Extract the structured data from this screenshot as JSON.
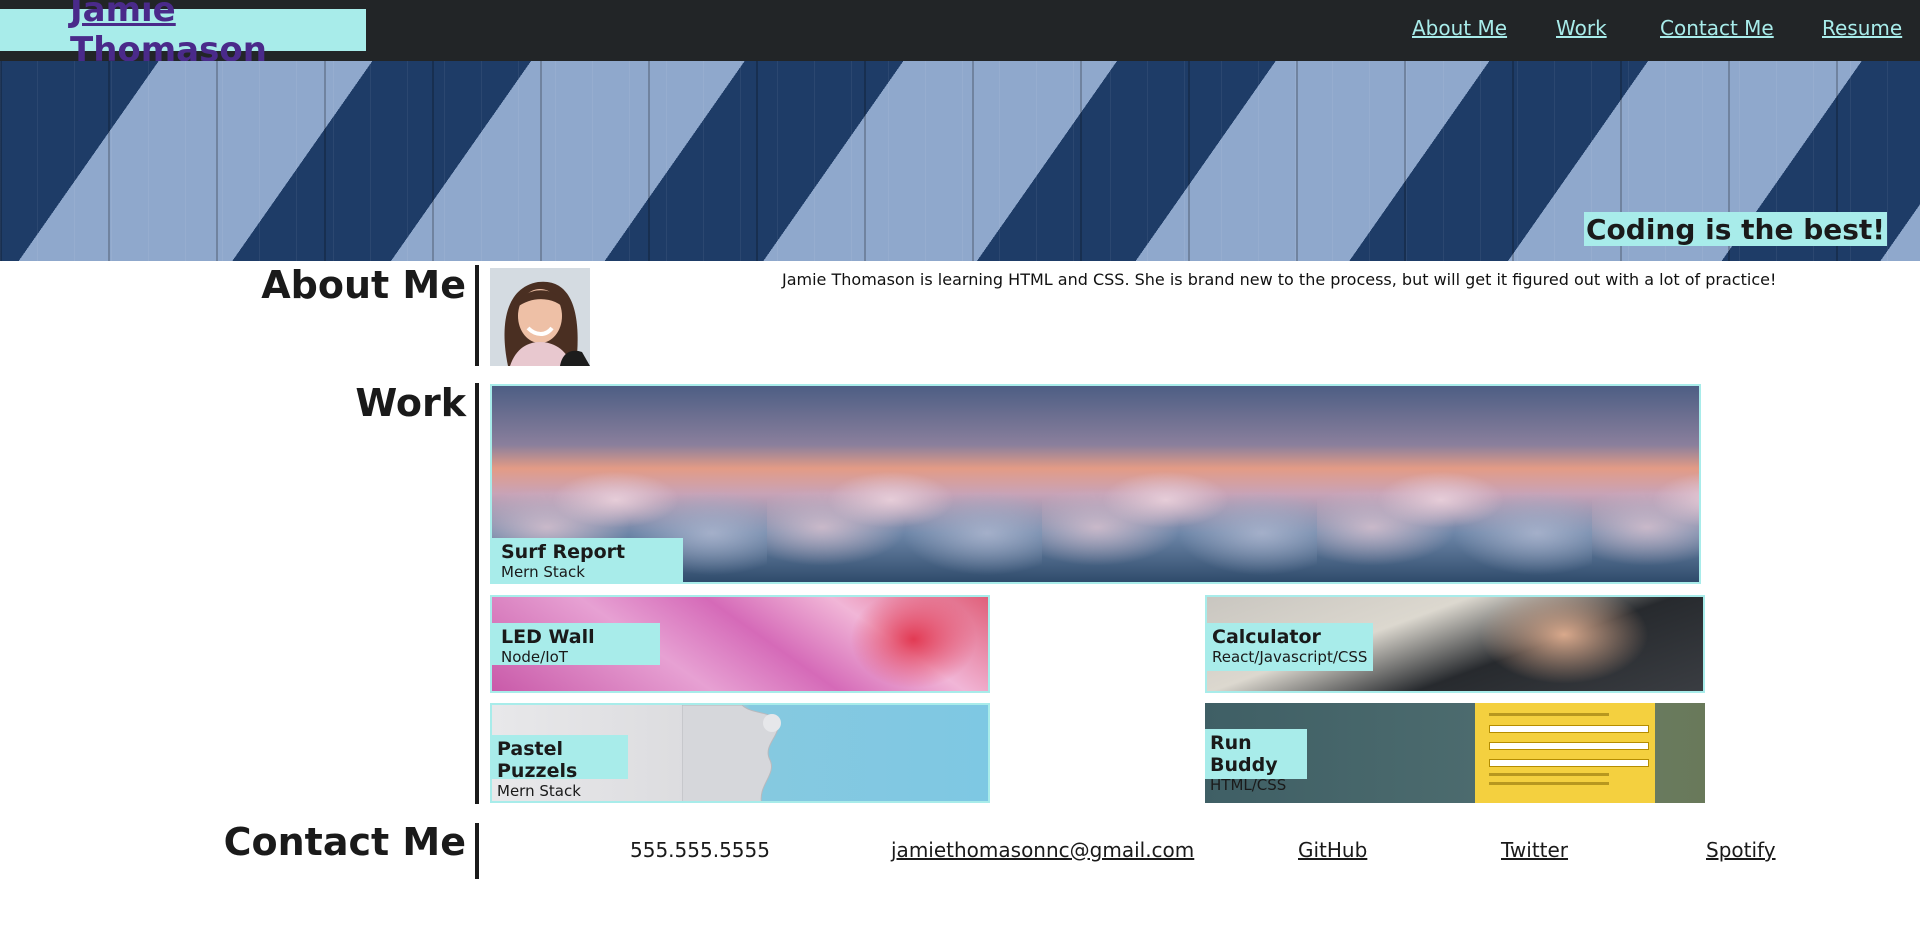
{
  "header": {
    "brand": "Jamie Thomason",
    "nav": [
      "About Me",
      "Work",
      "Contact Me",
      "Resume"
    ]
  },
  "hero": {
    "tagline": "Coding is the best!"
  },
  "about": {
    "title": "About Me",
    "text": "Jamie Thomason is learning HTML and CSS. She is brand new to the process, but will get it figured out with a lot of practice!"
  },
  "work": {
    "title": "Work",
    "projects": [
      {
        "name": "Surf Report",
        "tech": "Mern Stack"
      },
      {
        "name": "LED Wall",
        "tech": "Node/IoT"
      },
      {
        "name": "Calculator",
        "tech": "React/Javascript/CSS"
      },
      {
        "name": "Pastel Puzzels",
        "tech": "Mern Stack"
      },
      {
        "name": "Run Buddy",
        "tech": "HTML/CSS"
      }
    ]
  },
  "contact": {
    "title": "Contact Me",
    "phone": "555.555.5555",
    "email": "jamiethomasonnc@gmail.com",
    "links": [
      "GitHub",
      "Twitter",
      "Spotify"
    ]
  },
  "colors": {
    "accent": "#a8ecea",
    "header_bg": "#222527",
    "brand_text": "#4a2a8a"
  }
}
